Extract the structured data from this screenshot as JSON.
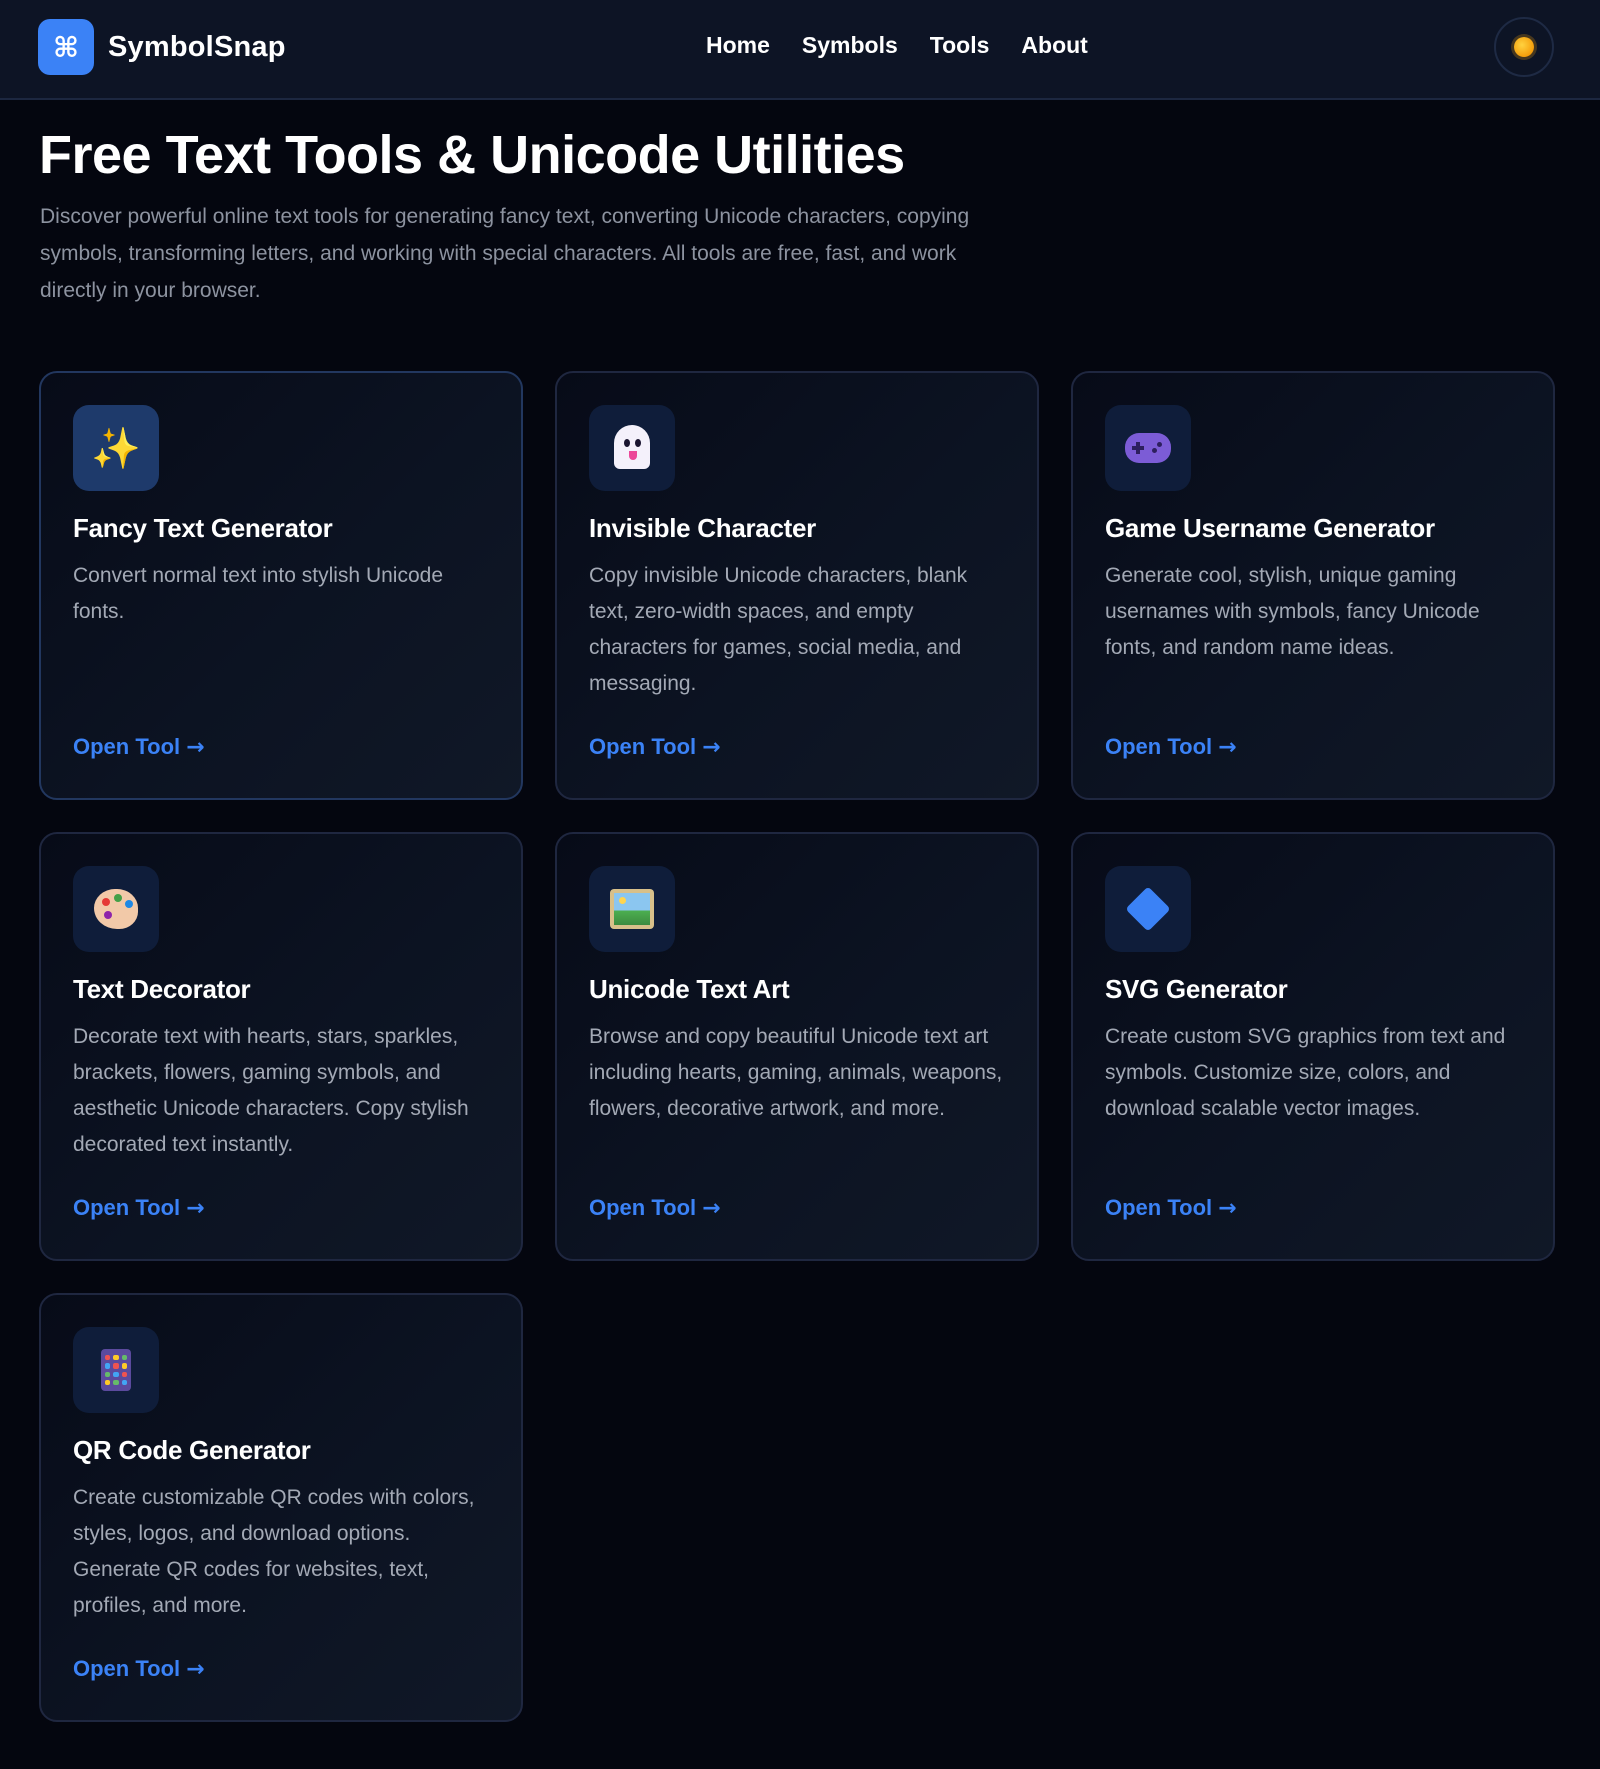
{
  "brand": {
    "logo_glyph": "⌘",
    "name": "SymbolSnap",
    "accent": "#3b82f6"
  },
  "nav": {
    "items": [
      "Home",
      "Symbols",
      "Tools",
      "About"
    ]
  },
  "theme_toggle": {
    "icon": "sun-icon"
  },
  "hero": {
    "title": "Free Text Tools & Unicode Utilities",
    "subtitle": "Discover powerful online text tools for generating fancy text, converting Unicode characters, copying symbols, transforming letters, and working with special characters. All tools are free, fast, and work directly in your browser."
  },
  "cards": [
    {
      "icon": "sparkles-icon",
      "title": "Fancy Text Generator",
      "description": "Convert normal text into stylish Unicode fonts.",
      "link": "Open Tool"
    },
    {
      "icon": "ghost-icon",
      "title": "Invisible Character",
      "description": "Copy invisible Unicode characters, blank text, zero-width spaces, and empty characters for games, social media, and messaging.",
      "link": "Open Tool"
    },
    {
      "icon": "gamepad-icon",
      "title": "Game Username Generator",
      "description": "Generate cool, stylish, unique gaming usernames with symbols, fancy Unicode fonts, and random name ideas.",
      "link": "Open Tool"
    },
    {
      "icon": "palette-icon",
      "title": "Text Decorator",
      "description": "Decorate text with hearts, stars, sparkles, brackets, flowers, gaming symbols, and aesthetic Unicode characters. Copy stylish decorated text instantly.",
      "link": "Open Tool"
    },
    {
      "icon": "framed-picture-icon",
      "title": "Unicode Text Art",
      "description": "Browse and copy beautiful Unicode text art including hearts, gaming, animals, weapons, flowers, decorative artwork, and more.",
      "link": "Open Tool"
    },
    {
      "icon": "blue-diamond-icon",
      "title": "SVG Generator",
      "description": "Create custom SVG graphics from text and symbols. Customize size, colors, and download scalable vector images.",
      "link": "Open Tool"
    },
    {
      "icon": "abacus-icon",
      "title": "QR Code Generator",
      "description": "Create customizable QR codes with colors, styles, logos, and download options. Generate QR codes for websites, text, profiles, and more.",
      "link": "Open Tool"
    }
  ],
  "link_arrow": "→"
}
